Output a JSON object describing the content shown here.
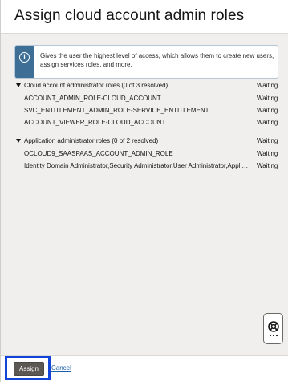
{
  "dialog": {
    "title": "Assign cloud account admin roles"
  },
  "info": {
    "icon": "info-icon",
    "text": "Gives the user the highest level of access, which allows them to create new users, assign services roles, and more."
  },
  "sections": [
    {
      "label": "Cloud account administrator roles (0 of 3 resolved)",
      "status": "Waiting",
      "rows": [
        {
          "name": "ACCOUNT_ADMIN_ROLE-CLOUD_ACCOUNT",
          "status": "Waiting"
        },
        {
          "name": "SVC_ENTITLEMENT_ADMIN_ROLE-SERVICE_ENTITLEMENT",
          "status": "Waiting"
        },
        {
          "name": "ACCOUNT_VIEWER_ROLE-CLOUD_ACCOUNT",
          "status": "Waiting"
        }
      ]
    },
    {
      "label": "Application administrator roles (0 of 2 resolved)",
      "status": "Waiting",
      "rows": [
        {
          "name": "OCLOUD9_SAASPAAS_ACCOUNT_ADMIN_ROLE",
          "status": "Waiting"
        },
        {
          "name": "Identity Domain Administrator,Security Administrator,User Administrator,Application Administrator",
          "status": "Waiting"
        }
      ]
    }
  ],
  "footer": {
    "assign_label": "Assign",
    "cancel_label": "Cancel"
  },
  "help_widget": {
    "icon": "life-ring-icon"
  },
  "colors": {
    "accent": "#3c6e96",
    "highlight": "#1145d8",
    "button": "#5b5854",
    "link": "#1a5fa8"
  }
}
